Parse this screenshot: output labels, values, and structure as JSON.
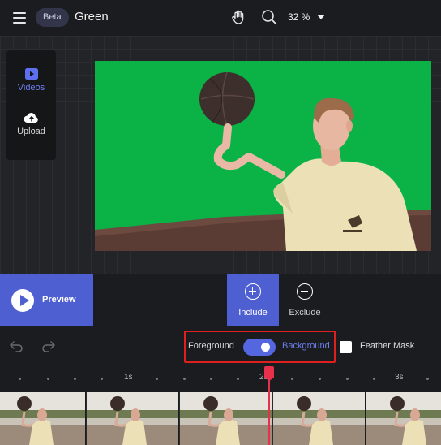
{
  "header": {
    "badge": "Beta",
    "title": "Green",
    "zoom": "32 %",
    "icons": [
      "menu-icon",
      "hand-icon",
      "search-icon",
      "chevron-down-icon"
    ]
  },
  "sidebar": {
    "items": [
      {
        "label": "Videos",
        "icon": "play-square-icon",
        "active": true
      },
      {
        "label": "Upload",
        "icon": "cloud-upload-icon",
        "active": false
      }
    ]
  },
  "controls": {
    "preview_label": "Preview",
    "include_label": "Include",
    "exclude_label": "Exclude"
  },
  "mask_options": {
    "foreground_label": "Foreground",
    "background_label": "Background",
    "toggle_state": "background",
    "feather_label": "Feather Mask",
    "feather_checked": false
  },
  "timeline": {
    "ticks": [
      "1s",
      "2s",
      "3s"
    ],
    "thumbnail_count": 5
  },
  "colors": {
    "accent": "#4e5fd1",
    "green_screen": "#0bb346",
    "highlight_box": "#e0201e",
    "playhead": "#e8304a"
  }
}
